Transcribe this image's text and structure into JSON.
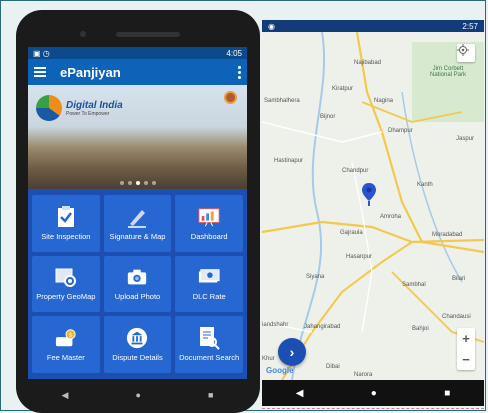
{
  "left_phone": {
    "status_time": "4:05",
    "app_title": "ePanjiyan",
    "banner": {
      "brand": "Digital India",
      "tagline": "Power To Empower"
    },
    "tiles": [
      {
        "label": "Site Inspection",
        "icon": "checklist-icon"
      },
      {
        "label": "Signature & Map",
        "icon": "pen-icon"
      },
      {
        "label": "Dashboard",
        "icon": "chart-board-icon"
      },
      {
        "label": "Property GeoMap",
        "icon": "geomap-icon"
      },
      {
        "label": "Upload Photo",
        "icon": "camera-icon"
      },
      {
        "label": "DLC Rate",
        "icon": "money-icon"
      },
      {
        "label": "Fee Master",
        "icon": "fee-icon"
      },
      {
        "label": "Dispute Details",
        "icon": "court-icon"
      },
      {
        "label": "Document Search",
        "icon": "document-search-icon"
      }
    ],
    "nav": {
      "back": "◀",
      "home": "●",
      "recent": "■"
    }
  },
  "right_phone": {
    "status_time": "2:57",
    "places": {
      "najibabad": "Najibabad",
      "jim_corbett": "Jim Corbett",
      "national_park": "National Park",
      "kiratpur": "Kiratpur",
      "nagina": "Nagina",
      "sambhalhera": "Sambhalhera",
      "bijnor": "Bijnor",
      "dhampur": "Dhampur",
      "jaspur": "Jaspur",
      "hastinapur": "Hastinapur",
      "chandpur": "Chandpur",
      "kanth": "Kanth",
      "amroha": "Amroha",
      "gajraula": "Gajraula",
      "moradabad": "Moradabad",
      "hasanpur": "Hasanpur",
      "siyana": "Siyana",
      "sambhal": "Sambhal",
      "bilari": "Bilari",
      "chandausi": "Chandausi",
      "bulandshahr": "landshahr",
      "jahangirabad": "Jahangirabad",
      "bahjoi": "Bahjoi",
      "khurja": "Khur",
      "dibai": "Dibai",
      "narora": "Narora"
    },
    "zoom_in": "+",
    "zoom_out": "−",
    "fab_label": "›",
    "google": "Google",
    "nav": {
      "back": "◀",
      "home": "●",
      "recent": "■"
    },
    "colors": {
      "road_major": "#f2c94c",
      "road_minor": "#ffffff",
      "water": "#a9c9e8",
      "pin": "#2a54d1"
    }
  }
}
